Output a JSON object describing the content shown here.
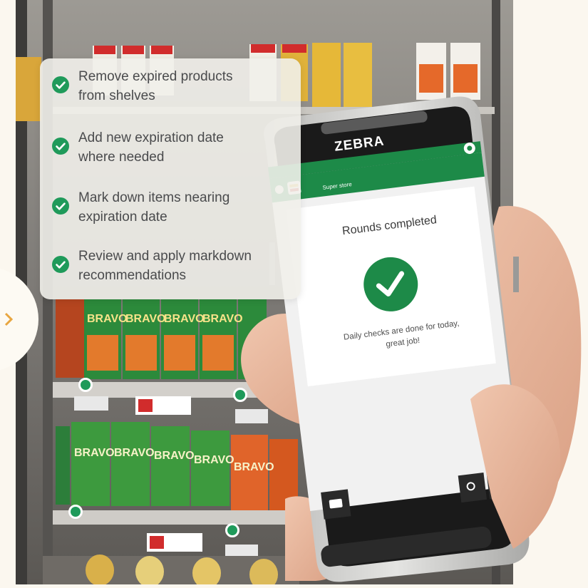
{
  "checklist": {
    "items": [
      {
        "line1": "Remove expired products",
        "line2": "from shelves"
      },
      {
        "line1": "Add new expiration date",
        "line2": "where needed"
      },
      {
        "line1": "Mark down items nearing",
        "line2": "expiration date"
      },
      {
        "line1": "Review and apply markdown",
        "line2": "recommendations"
      }
    ]
  },
  "device": {
    "brand": "ZEBRA",
    "app_header": "Super store",
    "status_title": "Rounds completed",
    "message_line1": "Daily checks are done for today,",
    "message_line2": "great job!",
    "icons": [
      "gear-icon",
      "close-icon",
      "checkmark-icon",
      "search-icon",
      "chat-icon",
      "print-icon"
    ]
  },
  "shelf": {
    "product_brand": "BRAVO"
  },
  "colors": {
    "accent_green": "#1f9a5a",
    "app_bar_green": "#1d8a48",
    "checklist_bg": "#f1efea",
    "text_gray": "#4a4b4d"
  }
}
